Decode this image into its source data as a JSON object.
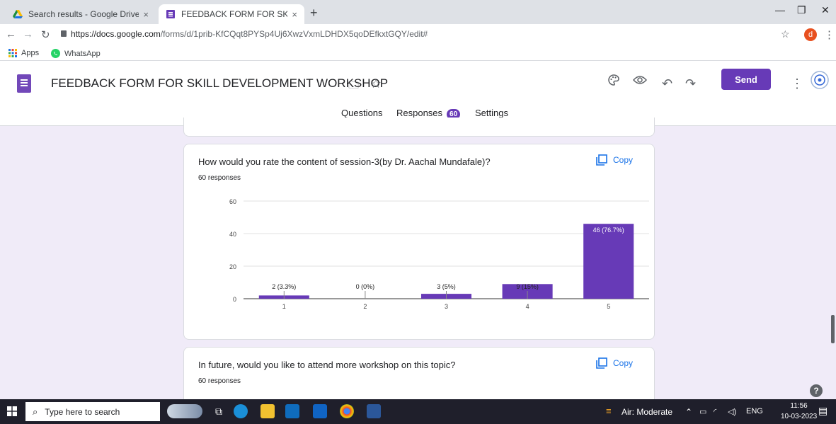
{
  "browser": {
    "tabs": [
      {
        "title": "Search results - Google Drive",
        "close": "×"
      },
      {
        "title": "FEEDBACK FORM FOR SKILL DEV",
        "close": "×"
      }
    ],
    "new_tab": "+",
    "url_host": "https://docs.google.com",
    "url_path": "/forms/d/1prib-KfCQqt8PYSp4Uj6XwzVxmLDHDX5qoDEfkxtGQY/edit#",
    "profile_initial": "d",
    "bookmarks": [
      "Apps",
      "WhatsApp"
    ]
  },
  "form": {
    "title": "FEEDBACK FORM FOR SKILL DEVELOPMENT WORKSHOP",
    "send_label": "Send",
    "tabs": {
      "questions": "Questions",
      "responses": "Responses",
      "responses_count": "60",
      "settings": "Settings"
    }
  },
  "question1": {
    "title": "How would you rate the content of session-3(by Dr. Aachal Mundafale)?",
    "responses": "60 responses",
    "copy_label": "Copy"
  },
  "question2": {
    "title": "In future, would you like to attend more workshop on this topic?",
    "responses": "60 responses",
    "copy_label": "Copy"
  },
  "chart_data": {
    "type": "bar",
    "categories": [
      "1",
      "2",
      "3",
      "4",
      "5"
    ],
    "values": [
      2,
      0,
      3,
      9,
      46
    ],
    "labels": [
      "2 (3.3%)",
      "0 (0%)",
      "3 (5%)",
      "9 (15%)",
      "46 (76.7%)"
    ],
    "yticks": [
      "0",
      "20",
      "40",
      "60"
    ],
    "ylim": [
      0,
      60
    ],
    "color": "#673ab7",
    "grid": true
  },
  "taskbar": {
    "search_placeholder": "Type here to search",
    "air": "Air: Moderate",
    "lang": "ENG",
    "time": "11:56",
    "date": "10-03-2023"
  },
  "help_label": "?"
}
